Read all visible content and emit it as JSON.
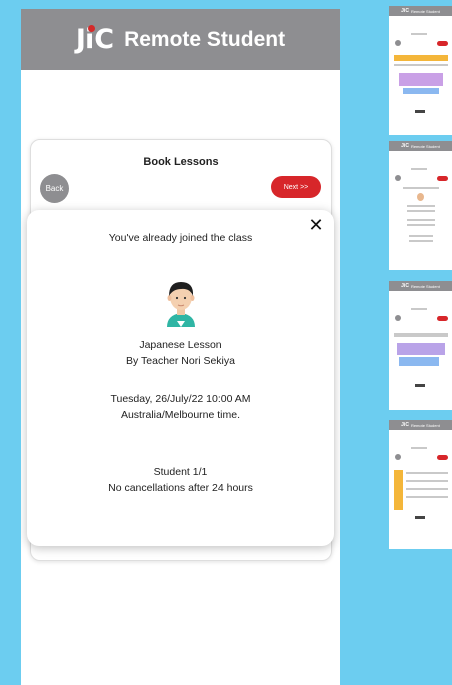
{
  "app": {
    "logo_text": "JiC",
    "title": "Remote Student"
  },
  "booking": {
    "title": "Book Lessons",
    "back_label": "Back",
    "next_label": "Next >>"
  },
  "modal": {
    "message": "You've already joined the class",
    "lesson": "Japanese Lesson",
    "teacher": "By Teacher Nori Sekiya",
    "datetime": "Tuesday, 26/July/22 10:00 AM Australia/Melbourne time.",
    "students": "Student 1/1",
    "policy": "No cancellations after 24 hours"
  },
  "icons": {
    "close": "close-icon",
    "avatar": "teacher-avatar"
  },
  "colors": {
    "background": "#6ccdf0",
    "header": "#8e8e91",
    "accent_red": "#d7262a"
  },
  "thumbnails": [
    {
      "header": "Remote Student"
    },
    {
      "header": "Remote Student"
    },
    {
      "header": "Remote Student"
    },
    {
      "header": "Remote Student"
    }
  ]
}
